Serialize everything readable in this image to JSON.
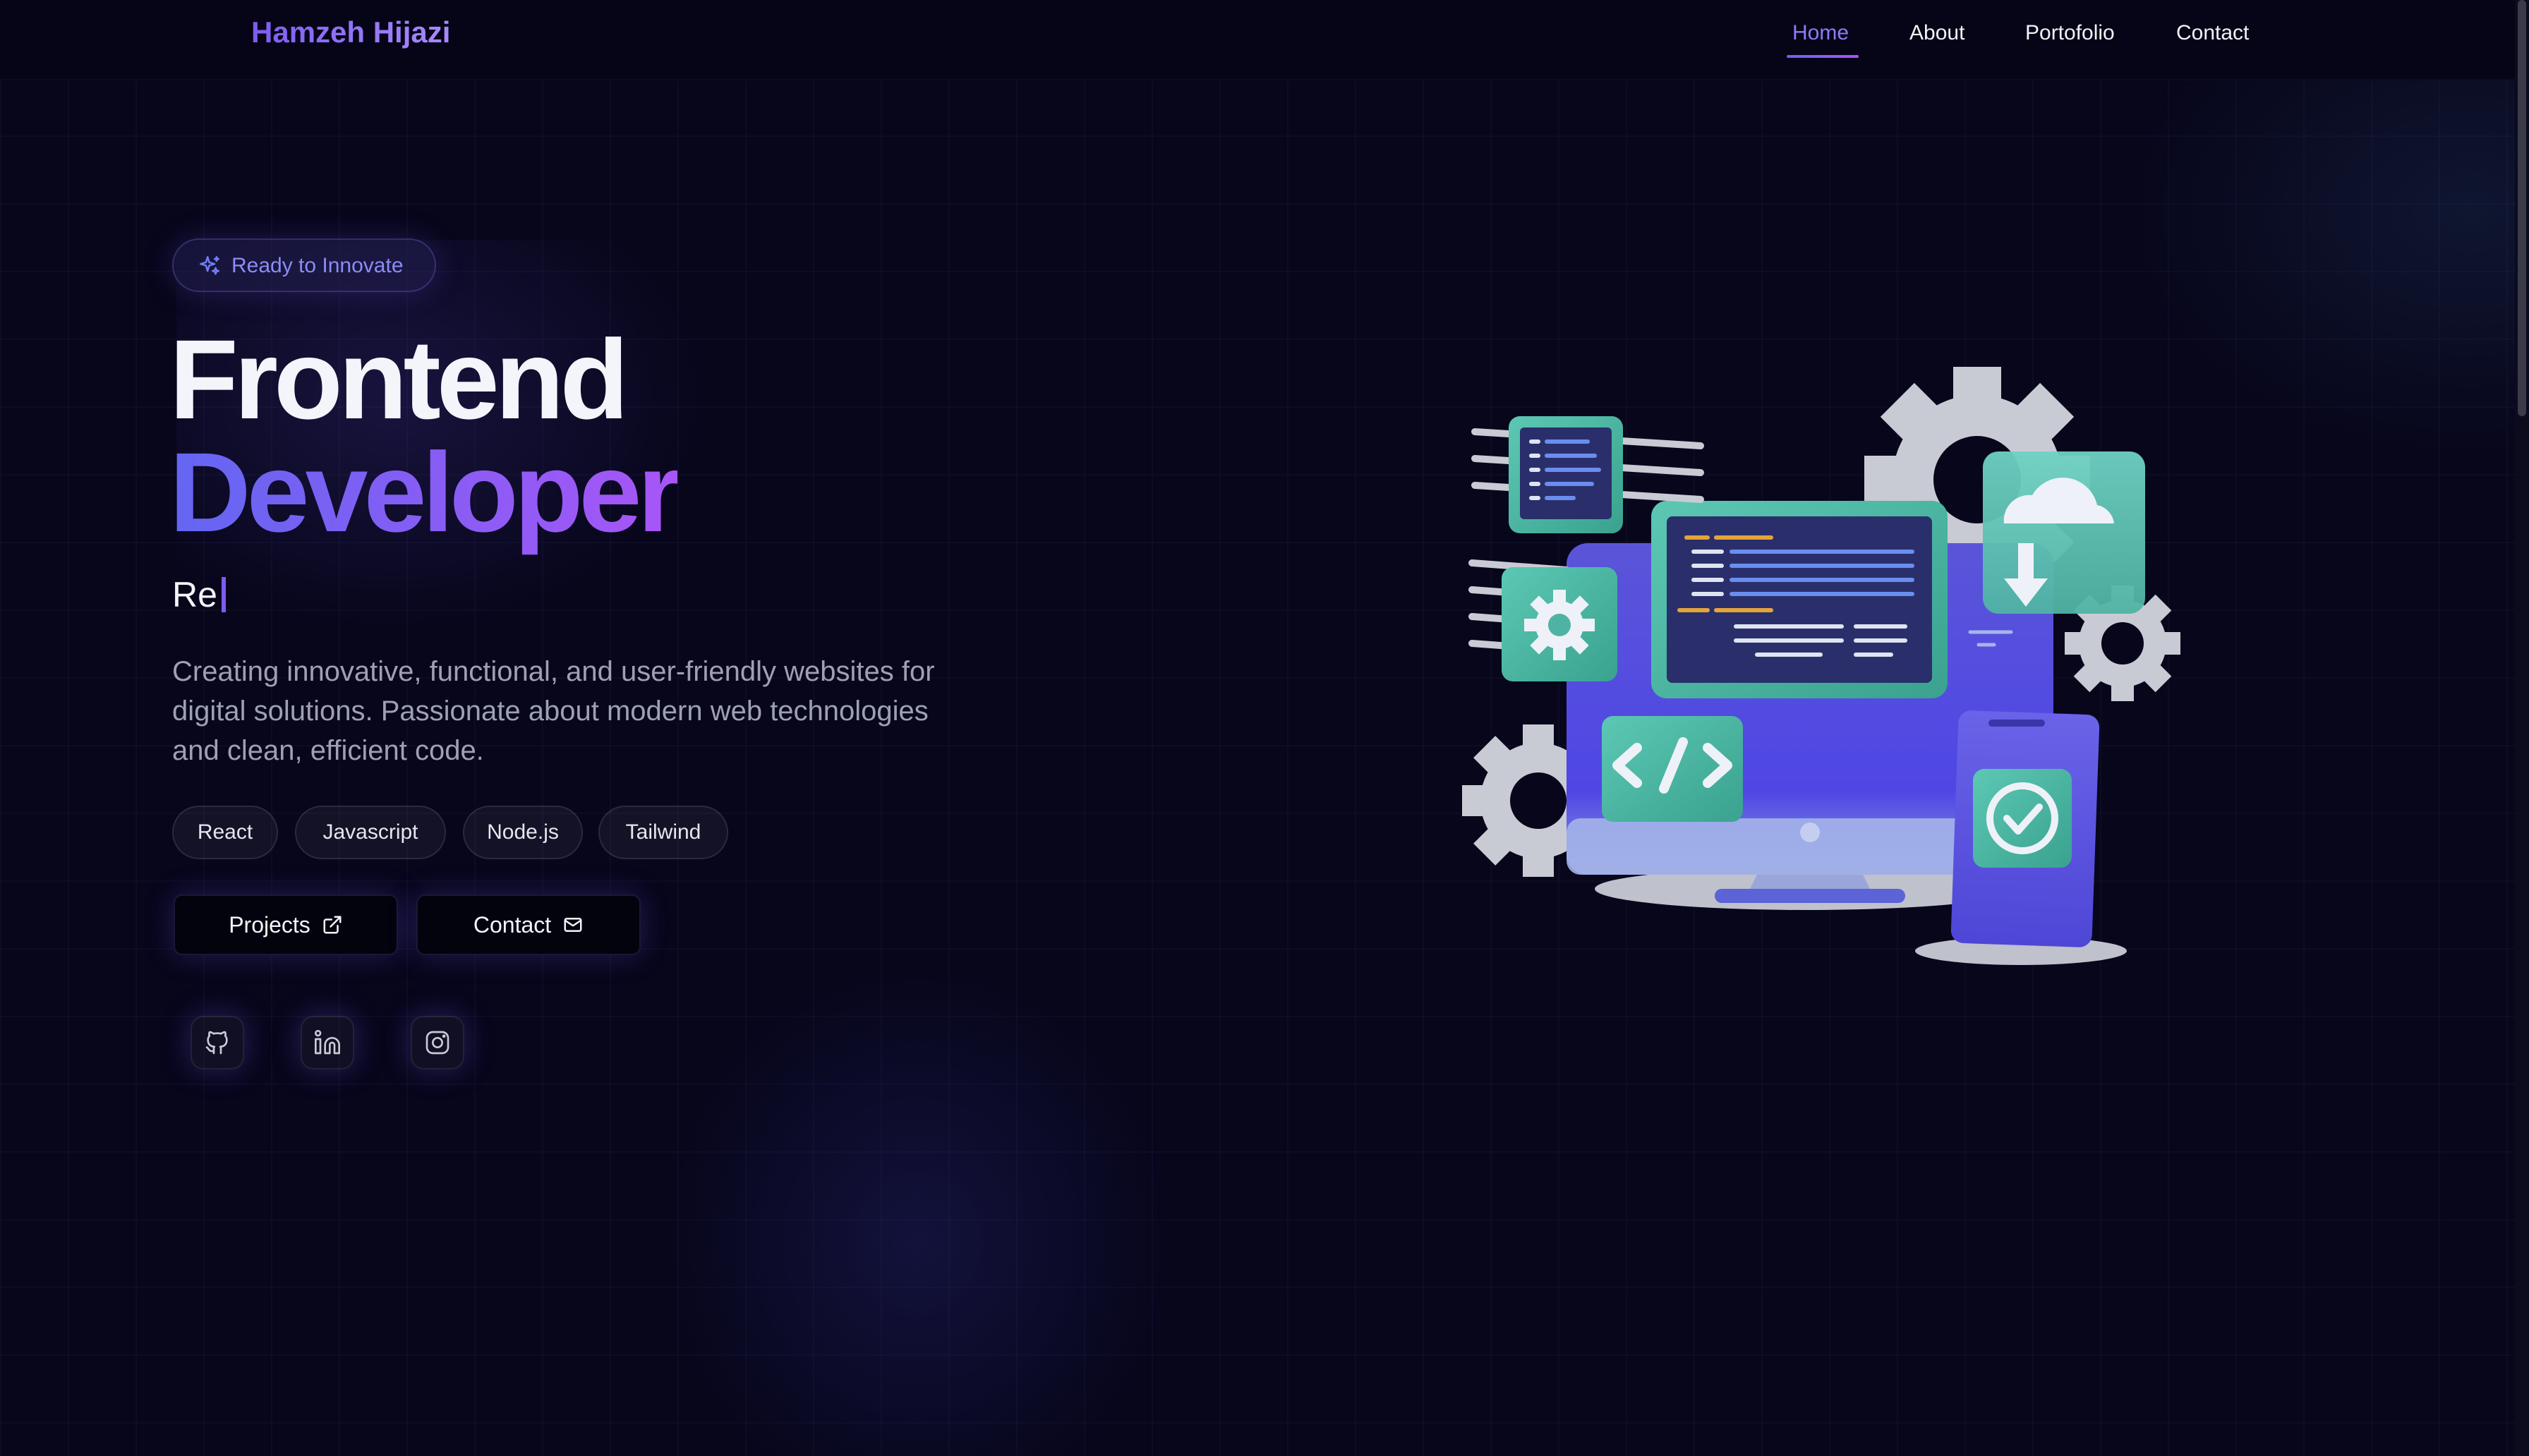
{
  "brand": "Hamzeh Hijazi",
  "nav": {
    "home": "Home",
    "about": "About",
    "portfolio": "Portofolio",
    "contact": "Contact"
  },
  "hero": {
    "badge": "Ready to Innovate",
    "title_line1": "Frontend",
    "title_line2": "Developer",
    "typed_text": "Re",
    "description": "Creating innovative, functional, and user-friendly websites for digital solutions. Passionate about modern web technologies and clean, efficient code.",
    "tech": [
      "React",
      "Javascript",
      "Node.js",
      "Tailwind"
    ],
    "buttons": {
      "projects": "Projects",
      "contact": "Contact"
    },
    "social": [
      "github-icon",
      "linkedin-icon",
      "instagram-icon"
    ]
  },
  "colors": {
    "accent": "#8b5cf6",
    "accent_start": "#6366f1",
    "accent_end": "#a855f7",
    "background": "#07061b"
  }
}
